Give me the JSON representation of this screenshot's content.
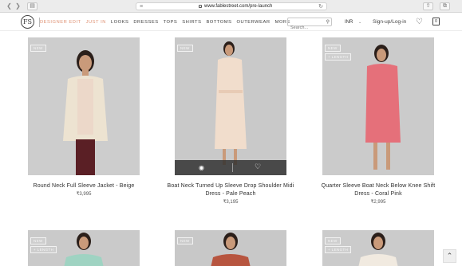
{
  "browser": {
    "url": "www.fablestreet.com/pre-launch"
  },
  "header": {
    "logo_text": "FS",
    "nav": [
      {
        "label": "DESIGNER EDIT",
        "accent": true
      },
      {
        "label": "JUST IN",
        "accent": true
      },
      {
        "label": "LOOKS",
        "accent": false
      },
      {
        "label": "DRESSES",
        "accent": false
      },
      {
        "label": "TOPS",
        "accent": false
      },
      {
        "label": "SHIRTS",
        "accent": false
      },
      {
        "label": "BOTTOMS",
        "accent": false
      },
      {
        "label": "OUTERWEAR",
        "accent": false
      },
      {
        "label": "MORE",
        "accent": false
      }
    ],
    "search_placeholder": "Search...",
    "currency": "INR",
    "signin": "Sign-up/Log-in",
    "accent_color": "#e09477"
  },
  "products": [
    {
      "name": "Round Neck Full Sleeve Jacket - Beige",
      "name_lines": [
        "Round Neck Full Sleeve Jacket - Beige"
      ],
      "price": "₹3,995",
      "badges": [
        "NEW"
      ],
      "bg": "#cdcdcd"
    },
    {
      "name": "Boat Neck Turned Up Sleeve Drop Shoulder Midi Dress - Pale Peach",
      "name_lines": [
        "Boat Neck Turned Up Sleeve Drop Shoulder Midi",
        "Dress - Pale Peach"
      ],
      "price": "₹3,195",
      "badges": [
        "NEW"
      ],
      "bg": "#c9c9c9"
    },
    {
      "name": "Quarter Sleeve Boat Neck Below Knee Shift Dress - Coral Pink",
      "name_lines": [
        "Quarter Sleeve Boat Neck Below Knee Shift",
        "Dress - Coral Pink"
      ],
      "price": "₹2,995",
      "badges": [
        "NEW",
        "+ LENGTH"
      ],
      "bg": "#cbcbcb"
    },
    {
      "badges": [
        "NEW",
        "+ LENGTH"
      ],
      "bg": "#cacaca"
    },
    {
      "badges": [
        "NEW"
      ],
      "bg": "#c8c8c8"
    },
    {
      "badges": [
        "NEW",
        "+ LENGTH"
      ],
      "bg": "#cbcbcb"
    }
  ]
}
